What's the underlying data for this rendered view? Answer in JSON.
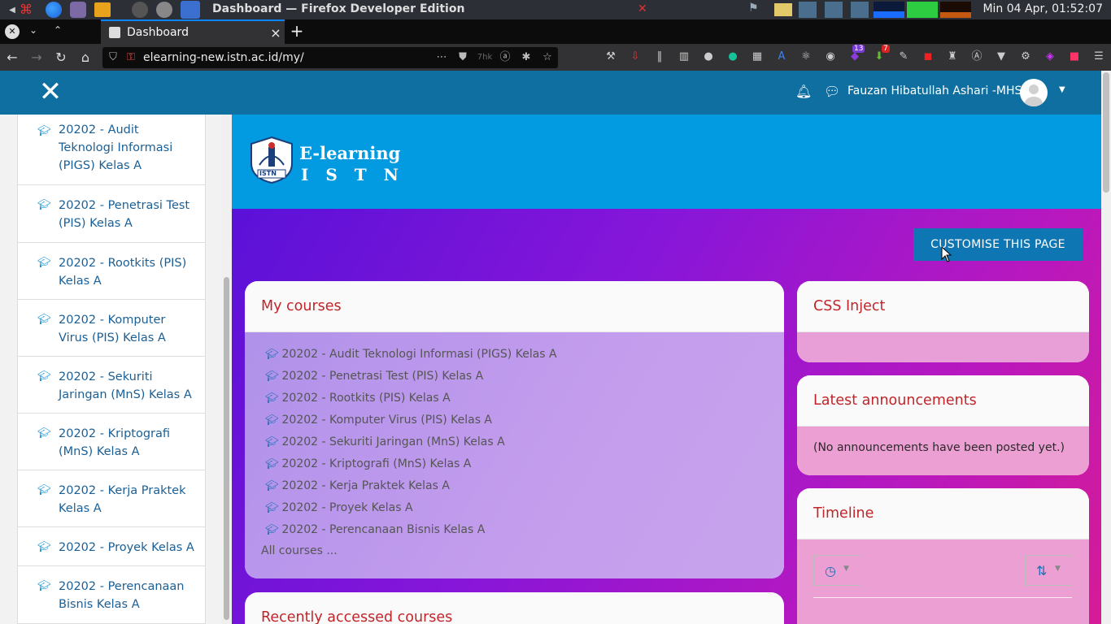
{
  "os": {
    "window_title": "Dashboard — Firefox Developer Edition",
    "clock": "Min 04 Apr, 01:52:07"
  },
  "browser": {
    "tab_label": "Dashboard",
    "url": "elearning-new.istn.ac.id/my/",
    "pocket_count": "7hk",
    "badge_13": "13",
    "badge_7": "7"
  },
  "header": {
    "user_name": "Fauzan Hibatullah Ashari -MHS"
  },
  "logo": {
    "line1": "E-learning",
    "line2": "I S T N",
    "emblem_text": "ISTN"
  },
  "drawer": {
    "items": [
      {
        "label": "20202 - Audit Teknologi Informasi (PIGS) Kelas A"
      },
      {
        "label": "20202 - Penetrasi Test (PIS) Kelas A"
      },
      {
        "label": "20202 - Rootkits (PIS) Kelas A"
      },
      {
        "label": "20202 - Komputer Virus (PIS) Kelas A"
      },
      {
        "label": "20202 - Sekuriti Jaringan (MnS) Kelas A"
      },
      {
        "label": "20202 - Kriptografi (MnS) Kelas A"
      },
      {
        "label": "20202 - Kerja Praktek Kelas A"
      },
      {
        "label": "20202 - Proyek Kelas A"
      },
      {
        "label": "20202 - Perencanaan Bisnis Kelas A"
      }
    ]
  },
  "main": {
    "customise_label": "CUSTOMISE THIS PAGE",
    "my_courses": {
      "title": "My courses",
      "courses": [
        "20202 - Audit Teknologi Informasi (PIGS) Kelas A",
        "20202 - Penetrasi Test (PIS) Kelas A",
        "20202 - Rootkits (PIS) Kelas A",
        "20202 - Komputer Virus (PIS) Kelas A",
        "20202 - Sekuriti Jaringan (MnS) Kelas A",
        "20202 - Kriptografi (MnS) Kelas A",
        "20202 - Kerja Praktek Kelas A",
        "20202 - Proyek Kelas A",
        "20202 - Perencanaan Bisnis Kelas A"
      ],
      "all_courses": "All courses ..."
    },
    "recent": {
      "title": "Recently accessed courses"
    },
    "css_inject": {
      "title": "CSS Inject"
    },
    "announcements": {
      "title": "Latest announcements",
      "empty": "(No announcements have been posted yet.)"
    },
    "timeline": {
      "title": "Timeline"
    }
  },
  "colors": {
    "header_bg": "#0f6fa0",
    "page_header_bg": "#029ae0",
    "block_title": "#c0252a",
    "button_bg": "#0f76b4"
  }
}
